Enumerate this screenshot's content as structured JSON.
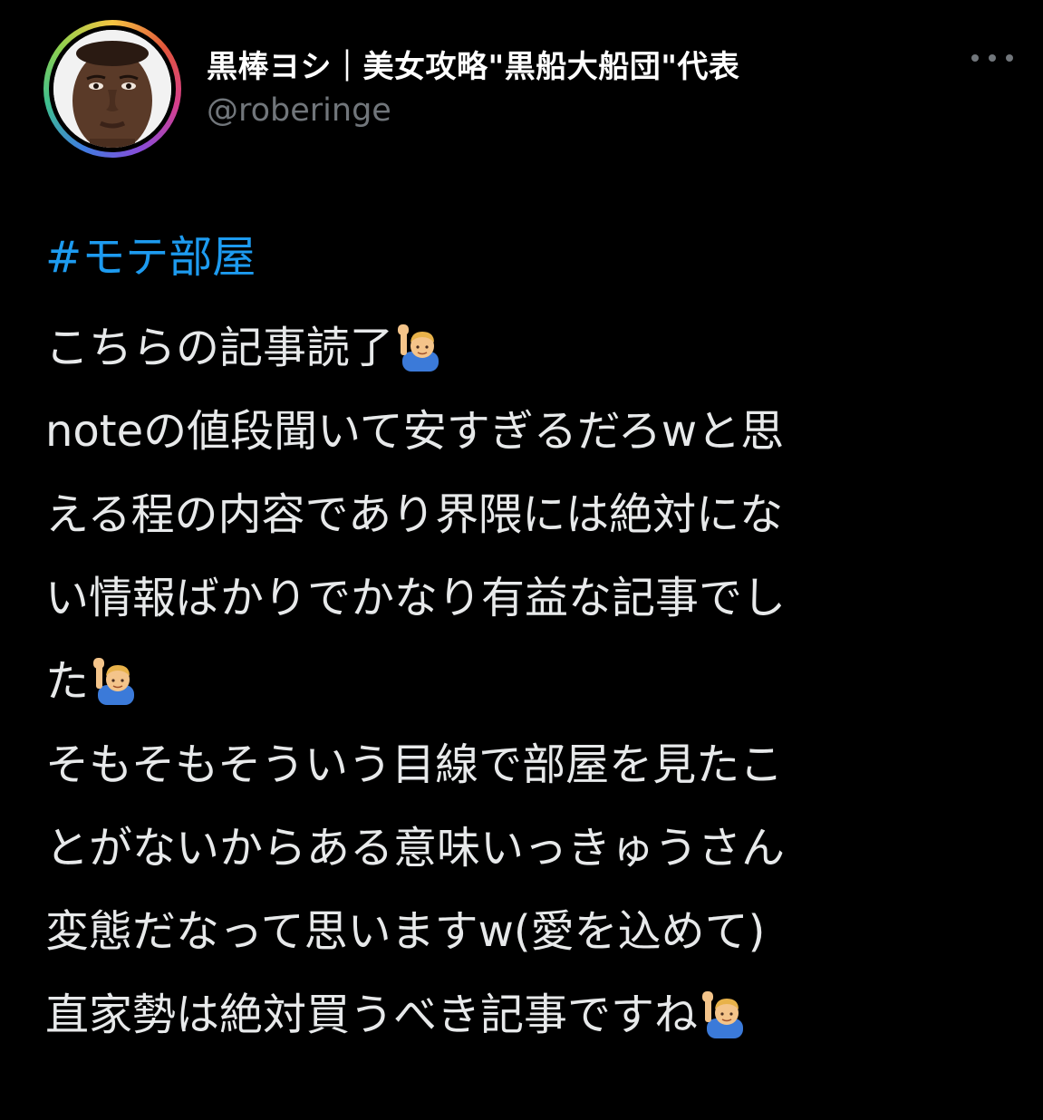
{
  "user": {
    "display_name": "黒棒ヨシ｜美女攻略\"黒船大船団\"代表",
    "handle": "@roberinge"
  },
  "tweet": {
    "hashtag": "#モテ部屋",
    "lines": [
      "こちらの記事読了",
      "noteの値段聞いて安すぎるだろwと思",
      "える程の内容であり界隈には絶対にな",
      "い情報ばかりでかなり有益な記事でし",
      "た",
      "そもそもそういう目線で部屋を見たこ",
      "とがないからある意味いっきゅうさん",
      "変態だなって思いますw(愛を込めて)",
      "直家勢は絶対買うべき記事ですね"
    ],
    "emoji_name": "person-raising-hand-icon"
  },
  "colors": {
    "background": "#000000",
    "text": "#e7e9ea",
    "secondary_text": "#71767b",
    "hashtag": "#1d9bf0"
  }
}
